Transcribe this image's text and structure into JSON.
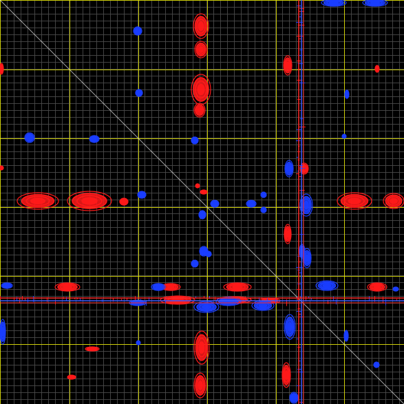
{
  "view": {
    "background_color": "#000000",
    "minor_grid_color": "#4a4a4a",
    "major_grid_color": "#e8e800",
    "diagonal_color": "#d8d8d8",
    "positive_contour_color": "#ff1a1a",
    "negative_contour_color": "#1a3dff",
    "crosshair_red_color": "#ff2a2a",
    "crosshair_blue_color": "#3c5cff",
    "minor_grid_divisions": 5,
    "major_grid_divisions": 6
  }
}
